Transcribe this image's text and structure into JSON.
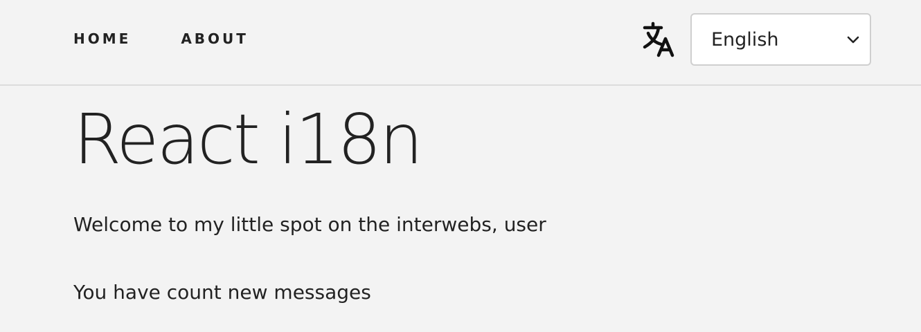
{
  "nav": {
    "links": [
      "HOME",
      "ABOUT"
    ]
  },
  "language": {
    "icon": "translate-icon",
    "selected": "English",
    "options": [
      "English"
    ]
  },
  "main": {
    "title": "React i18n",
    "welcome": "Welcome to my little spot on the interwebs, user",
    "messages": "You have count new messages"
  },
  "colors": {
    "background": "#f3f3f3",
    "text": "#222222",
    "divider": "#dcdcdc",
    "select_border": "#cfcfcf"
  }
}
